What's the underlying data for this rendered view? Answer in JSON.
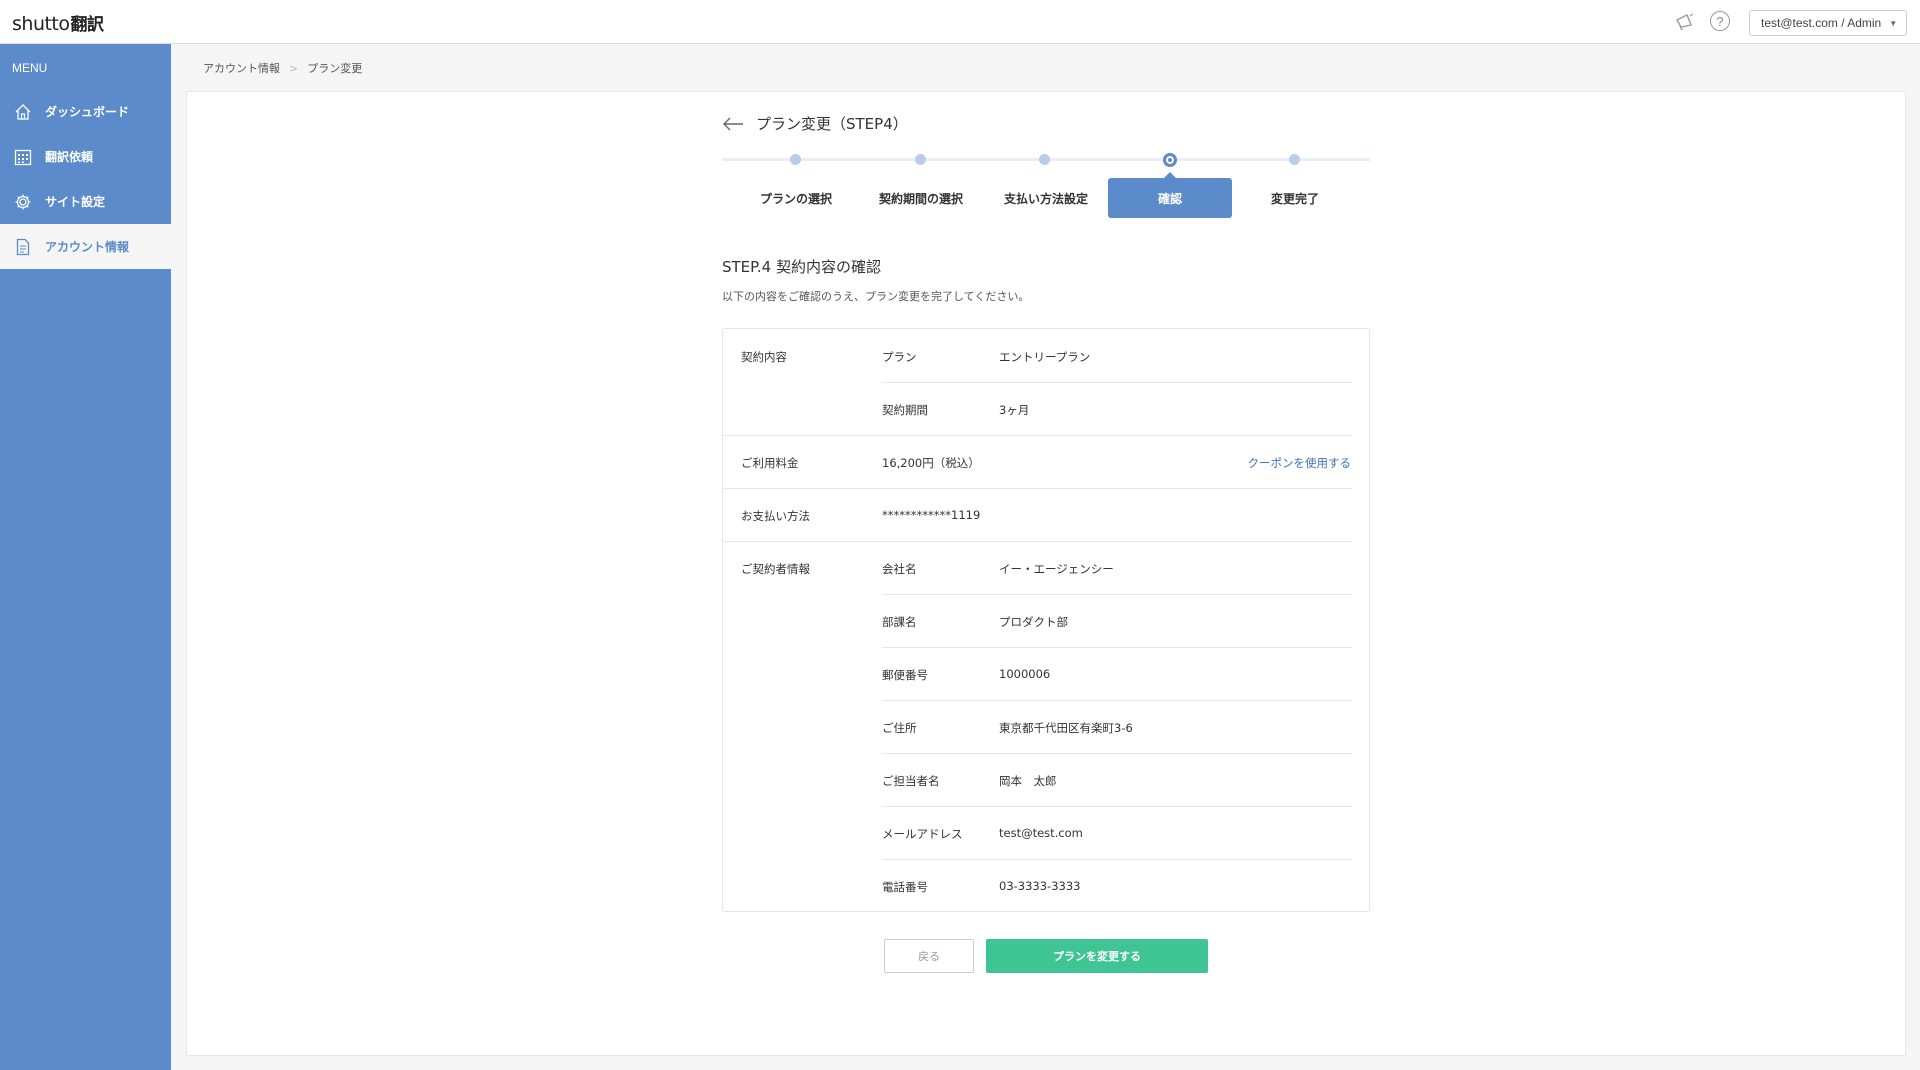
{
  "header": {
    "logo_latin": "shutto",
    "logo_ja": "翻訳",
    "user_label": "test@test.com / Admin",
    "help_glyph": "?",
    "bell_icon": "megaphone-icon"
  },
  "sidebar": {
    "menu_title": "MENU",
    "items": [
      {
        "label": "ダッシュボード",
        "icon": "home-icon"
      },
      {
        "label": "翻訳依頼",
        "icon": "calendar-grid-icon"
      },
      {
        "label": "サイト設定",
        "icon": "gear-icon"
      },
      {
        "label": "アカウント情報",
        "icon": "document-icon"
      }
    ],
    "active_index": 3,
    "colors": {
      "bg": "#5b8bcb",
      "active_bg": "#f5f5f5"
    }
  },
  "breadcrumb": [
    "アカウント情報",
    "プラン変更"
  ],
  "page": {
    "title": "プラン変更（STEP4）",
    "section_title": "STEP.4 契約内容の確認",
    "section_desc": "以下の内容をご確認のうえ、プラン変更を完了してください。"
  },
  "steps": [
    {
      "label": "プランの選択"
    },
    {
      "label": "契約期間の選択"
    },
    {
      "label": "支払い方法設定"
    },
    {
      "label": "確認"
    },
    {
      "label": "変更完了"
    }
  ],
  "current_step": 4,
  "contract": {
    "plan_section": "契約内容",
    "plan_label": "プラン",
    "plan_value": "エントリープラン",
    "period_label": "契約期間",
    "period_value": "3ヶ月",
    "fee_section": "ご利用料金",
    "fee_value": "16,200円（税込）",
    "coupon_link": "クーポンを使用する",
    "payment_section": "お支払い方法",
    "payment_value": "************1119",
    "contractor_section": "ご契約者情報",
    "company_label": "会社名",
    "company_value": "イー・エージェンシー",
    "dept_label": "部課名",
    "dept_value": "プロダクト部",
    "zip_label": "郵便番号",
    "zip_value": "1000006",
    "address_label": "ご住所",
    "address_value": "東京都千代田区有楽町3-6",
    "person_label": "ご担当者名",
    "person_value": "岡本　太郎",
    "email_label": "メールアドレス",
    "email_value": "test@test.com",
    "phone_label": "電話番号",
    "phone_value": "03-3333-3333"
  },
  "buttons": {
    "back": "戻る",
    "submit": "プランを変更する",
    "submit_color": "#3ec593"
  }
}
